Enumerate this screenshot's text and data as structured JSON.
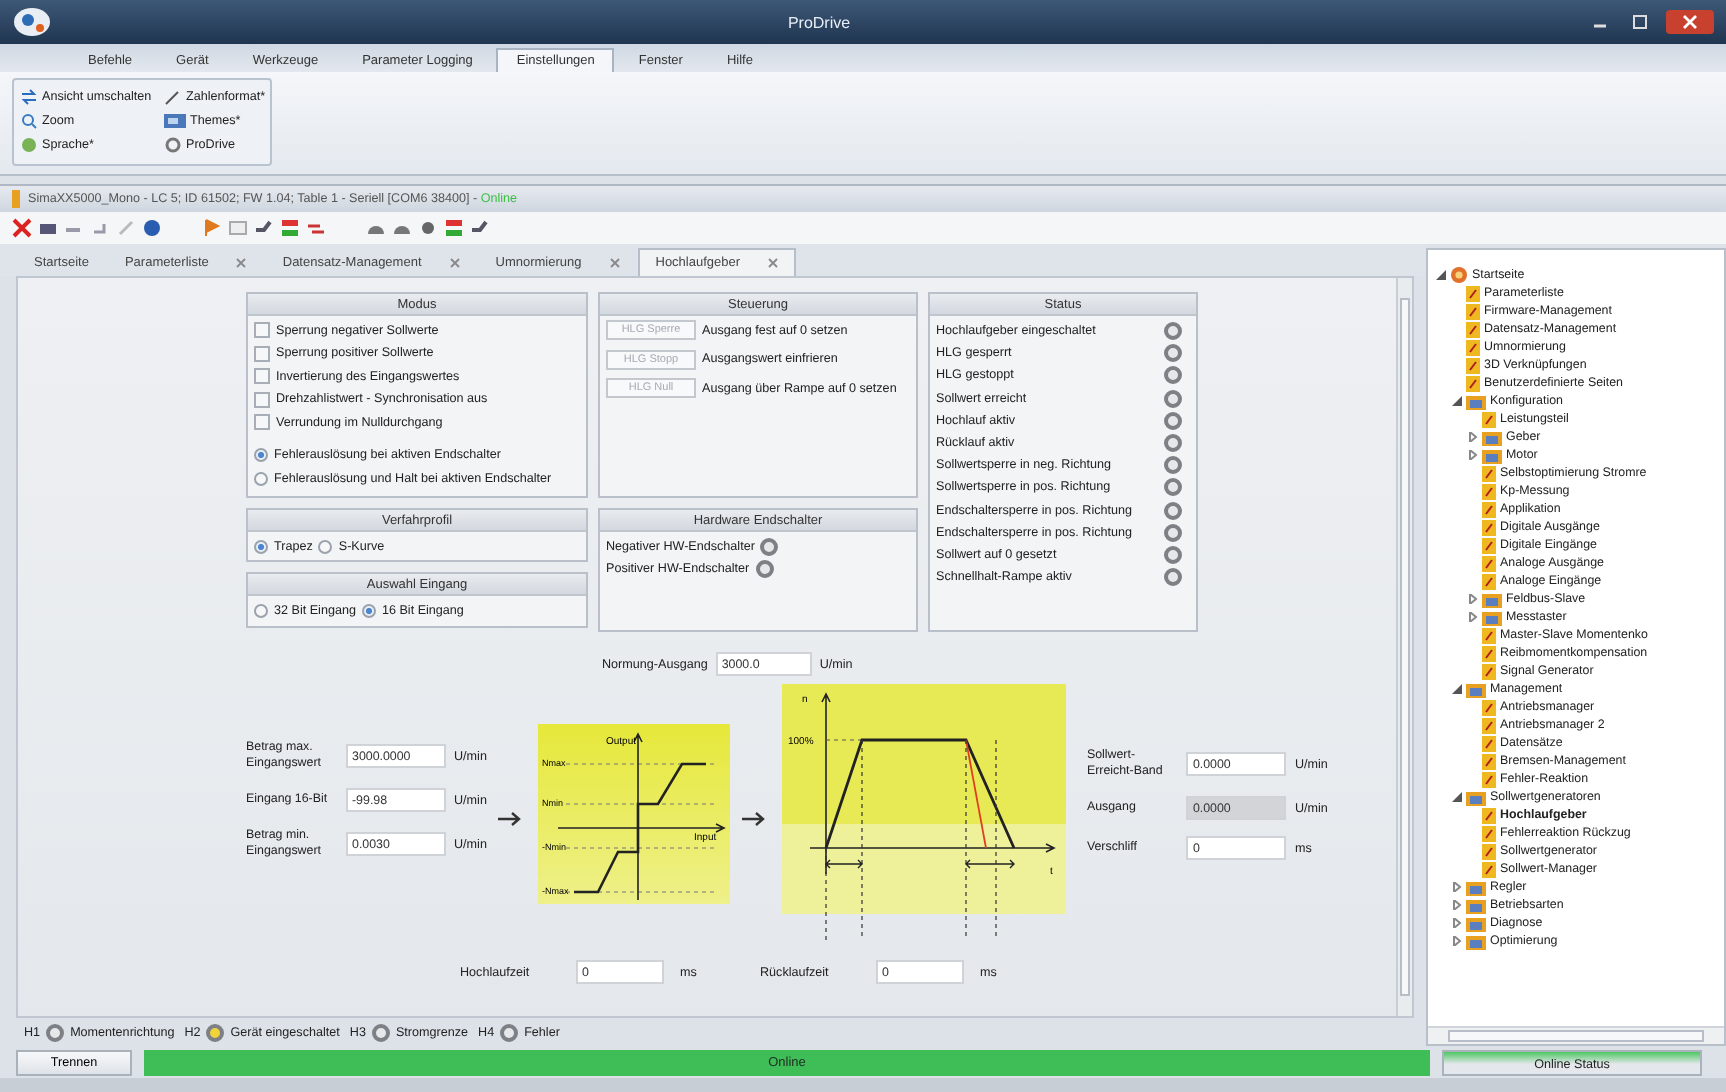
{
  "app_title": "ProDrive",
  "ribbon_tabs": [
    {
      "label": "Befehle",
      "selected": false
    },
    {
      "label": "Gerät",
      "selected": false
    },
    {
      "label": "Werkzeuge",
      "selected": false
    },
    {
      "label": "Parameter Logging",
      "selected": false
    },
    {
      "label": "Einstellungen",
      "selected": true
    },
    {
      "label": "Fenster",
      "selected": false
    },
    {
      "label": "Hilfe",
      "selected": false
    }
  ],
  "ribbon_commands": [
    {
      "label": "Ansicht umschalten"
    },
    {
      "label": "Zahlenformat*"
    },
    {
      "label": "Zoom"
    },
    {
      "label": "Themes*"
    },
    {
      "label": "Sprache*"
    },
    {
      "label": "ProDrive"
    }
  ],
  "document": {
    "title": "SimaXX5000_Mono - LC 5; ID 61502; FW 1.04; Table 1 - Seriell [COM6 38400] - ",
    "status": "Online"
  },
  "tabs": [
    {
      "label": "Startseite",
      "closable": false,
      "selected": false
    },
    {
      "label": "Parameterliste",
      "closable": true,
      "selected": false
    },
    {
      "label": "Datensatz-Management",
      "closable": true,
      "selected": false
    },
    {
      "label": "Umnormierung",
      "closable": true,
      "selected": false
    },
    {
      "label": "Hochlaufgeber",
      "closable": true,
      "selected": true
    }
  ],
  "modus": {
    "title": "Modus",
    "checkboxes": [
      {
        "label": "Sperrung negativer Sollwerte",
        "checked": false
      },
      {
        "label": "Sperrung positiver Sollwerte",
        "checked": false
      },
      {
        "label": "Invertierung des Eingangswertes",
        "checked": false
      },
      {
        "label": "Drehzahlistwert - Synchronisation aus",
        "checked": false
      },
      {
        "label": "Verrundung im Nulldurchgang",
        "checked": false
      }
    ],
    "radios": [
      {
        "label": "Fehlerauslösung bei aktiven Endschalter",
        "selected": true
      },
      {
        "label": "Fehlerauslösung und Halt bei aktiven Endschalter",
        "selected": false
      }
    ]
  },
  "steuerung": {
    "title": "Steuerung",
    "rows": [
      {
        "button": "HLG Sperre",
        "disabled": true,
        "label": "Ausgang fest auf 0 setzen"
      },
      {
        "button": "HLG Stopp",
        "disabled": true,
        "label": "Ausgangswert einfrieren"
      },
      {
        "button": "HLG Null",
        "disabled": true,
        "label": "Ausgang über Rampe auf 0 setzen"
      }
    ]
  },
  "status": {
    "title": "Status",
    "items": [
      {
        "label": "Hochlaufgeber eingeschaltet",
        "on": false
      },
      {
        "label": "HLG gesperrt",
        "on": false
      },
      {
        "label": "HLG gestoppt",
        "on": false
      },
      {
        "label": "Sollwert erreicht",
        "on": false
      },
      {
        "label": "Hochlauf aktiv",
        "on": false
      },
      {
        "label": "Rücklauf aktiv",
        "on": false
      },
      {
        "label": "Sollwertsperre in neg. Richtung",
        "on": false
      },
      {
        "label": "Sollwertsperre in pos. Richtung",
        "on": false
      },
      {
        "label": "Endschaltersperre in pos. Richtung",
        "on": false
      },
      {
        "label": "Endschaltersperre in pos. Richtung",
        "on": false
      },
      {
        "label": "Sollwert auf 0 gesetzt",
        "on": false
      },
      {
        "label": "Schnellhalt-Rampe aktiv",
        "on": false
      }
    ]
  },
  "verfahrprofil": {
    "title": "Verfahrprofil",
    "options": [
      {
        "label": "Trapez",
        "selected": true
      },
      {
        "label": "S-Kurve",
        "selected": false
      }
    ]
  },
  "hardware": {
    "title": "Hardware Endschalter",
    "items": [
      {
        "label": "Negativer HW-Endschalter",
        "on": false
      },
      {
        "label": "Positiver HW-Endschalter",
        "on": false
      }
    ]
  },
  "auswahl": {
    "title": "Auswahl Eingang",
    "options": [
      {
        "label": "32 Bit Eingang",
        "selected": false
      },
      {
        "label": "16 Bit Eingang",
        "selected": true
      }
    ]
  },
  "normung": {
    "label": "Normung-Ausgang",
    "value": "3000.0",
    "unit": "U/min"
  },
  "input_fields": [
    {
      "label": "Betrag max. Eingangswert",
      "value": "3000.0000",
      "unit": "U/min"
    },
    {
      "label": "Eingang 16-Bit",
      "value": "-99.98",
      "unit": "U/min"
    },
    {
      "label": "Betrag min. Eingangswert",
      "value": "0.0030",
      "unit": "U/min"
    }
  ],
  "transfer_chart": {
    "y_title": "Output",
    "x_title": "Input",
    "levels": [
      "Nmax",
      "Nmin",
      "-Nmin",
      "-Nmax"
    ]
  },
  "ramp_chart": {
    "y_title": "n",
    "level": "100%",
    "x_title": "t"
  },
  "output_fields": [
    {
      "label": "Sollwert-Erreicht-Band",
      "value": "0.0000",
      "unit": "U/min",
      "disabled": false
    },
    {
      "label": "Ausgang",
      "value": "0.0000",
      "unit": "U/min",
      "disabled": true
    },
    {
      "label": "Verschliff",
      "value": "0",
      "unit": "ms",
      "disabled": false
    }
  ],
  "times": [
    {
      "label": "Hochlaufzeit",
      "value": "0",
      "unit": "ms"
    },
    {
      "label": "Rücklaufzeit",
      "value": "0",
      "unit": "ms"
    }
  ],
  "leds": [
    {
      "code": "H1",
      "label": "Momentenrichtung",
      "on": false
    },
    {
      "code": "H2",
      "label": "Gerät eingeschaltet",
      "on": true
    },
    {
      "code": "H3",
      "label": "Stromgrenze",
      "on": false
    },
    {
      "code": "H4",
      "label": "Fehler",
      "on": false
    }
  ],
  "disconnect_button": "Trennen",
  "connection": "Online",
  "online_status": "Online Status",
  "tree": [
    {
      "label": "Startseite",
      "kind": "home",
      "expanded": true,
      "selected": false,
      "children": [
        {
          "label": "Parameterliste",
          "kind": "page",
          "selected": false
        },
        {
          "label": "Firmware-Management",
          "kind": "page",
          "selected": false
        },
        {
          "label": "Datensatz-Management",
          "kind": "page",
          "selected": false
        },
        {
          "label": "Umnormierung",
          "kind": "page",
          "selected": false
        },
        {
          "label": "3D Verknüpfungen",
          "kind": "page",
          "selected": false
        },
        {
          "label": "Benutzerdefinierte Seiten",
          "kind": "page",
          "selected": false
        },
        {
          "label": "Konfiguration",
          "kind": "folder",
          "expanded": true,
          "selected": false,
          "children": [
            {
              "label": "Leistungsteil",
              "kind": "page",
              "selected": false
            },
            {
              "label": "Geber",
              "kind": "folder",
              "expanded": false,
              "selected": false
            },
            {
              "label": "Motor",
              "kind": "folder",
              "expanded": false,
              "selected": false
            },
            {
              "label": "Selbstoptimierung Stromre",
              "kind": "page",
              "selected": false
            },
            {
              "label": "Kp-Messung",
              "kind": "page",
              "selected": false
            },
            {
              "label": "Applikation",
              "kind": "page",
              "selected": false
            },
            {
              "label": "Digitale Ausgänge",
              "kind": "page",
              "selected": false
            },
            {
              "label": "Digitale Eingänge",
              "kind": "page",
              "selected": false
            },
            {
              "label": "Analoge Ausgänge",
              "kind": "page",
              "selected": false
            },
            {
              "label": "Analoge Eingänge",
              "kind": "page",
              "selected": false
            },
            {
              "label": "Feldbus-Slave",
              "kind": "folder",
              "expanded": false,
              "selected": false
            },
            {
              "label": "Messtaster",
              "kind": "folder",
              "expanded": false,
              "selected": false
            },
            {
              "label": "Master-Slave Momentenko",
              "kind": "page",
              "selected": false
            },
            {
              "label": "Reibmomentkompensation",
              "kind": "page",
              "selected": false
            },
            {
              "label": "Signal Generator",
              "kind": "page",
              "selected": false
            }
          ]
        },
        {
          "label": "Management",
          "kind": "folder",
          "expanded": true,
          "selected": false,
          "children": [
            {
              "label": "Antriebsmanager",
              "kind": "page",
              "selected": false
            },
            {
              "label": "Antriebsmanager 2",
              "kind": "page",
              "selected": false
            },
            {
              "label": "Datensätze",
              "kind": "page",
              "selected": false
            },
            {
              "label": "Bremsen-Management",
              "kind": "page",
              "selected": false
            },
            {
              "label": "Fehler-Reaktion",
              "kind": "page",
              "selected": false
            }
          ]
        },
        {
          "label": "Sollwertgeneratoren",
          "kind": "folder",
          "expanded": true,
          "selected": false,
          "children": [
            {
              "label": "Hochlaufgeber",
              "kind": "page",
              "selected": true
            },
            {
              "label": "Fehlerreaktion Rückzug",
              "kind": "page",
              "selected": false
            },
            {
              "label": "Sollwertgenerator",
              "kind": "page",
              "selected": false
            },
            {
              "label": "Sollwert-Manager",
              "kind": "page",
              "selected": false
            }
          ]
        },
        {
          "label": "Regler",
          "kind": "folder",
          "expanded": false,
          "selected": false
        },
        {
          "label": "Betriebsarten",
          "kind": "folder",
          "expanded": false,
          "selected": false
        },
        {
          "label": "Diagnose",
          "kind": "folder",
          "expanded": false,
          "selected": false
        },
        {
          "label": "Optimierung",
          "kind": "folder",
          "expanded": false,
          "selected": false
        }
      ]
    }
  ]
}
